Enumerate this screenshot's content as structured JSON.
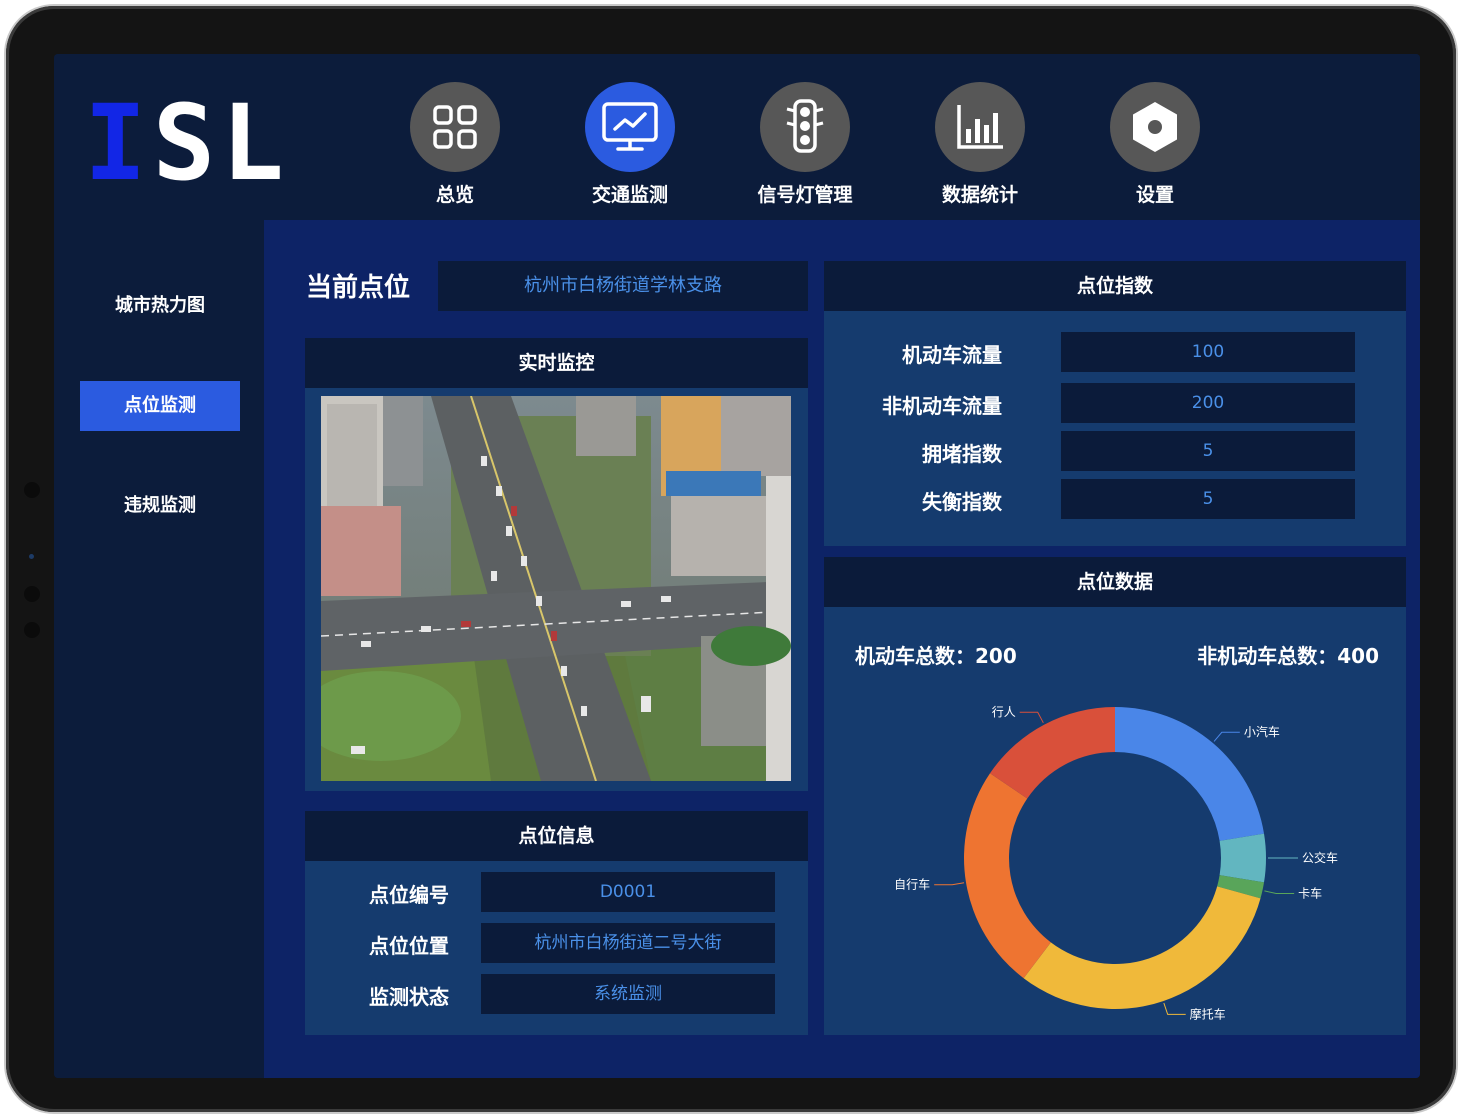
{
  "app": {
    "logo_part1": "I",
    "logo_part2": "SL"
  },
  "nav": {
    "items": [
      {
        "label": "总览",
        "icon": "grid-icon"
      },
      {
        "label": "交通监测",
        "icon": "monitor-chart-icon"
      },
      {
        "label": "信号灯管理",
        "icon": "traffic-light-icon"
      },
      {
        "label": "数据统计",
        "icon": "bar-chart-icon"
      },
      {
        "label": "设置",
        "icon": "hex-nut-icon"
      }
    ],
    "active_index": 1
  },
  "sidebar": {
    "items": [
      {
        "label": "城市热力图"
      },
      {
        "label": "点位监测"
      },
      {
        "label": "违规监测"
      }
    ],
    "active_index": 1
  },
  "current_point": {
    "label": "当前点位",
    "value": "杭州市白杨街道学林支路"
  },
  "live_monitor": {
    "title": "实时监控"
  },
  "point_info": {
    "title": "点位信息",
    "rows": [
      {
        "label": "点位编号",
        "value": "D0001"
      },
      {
        "label": "点位位置",
        "value": "杭州市白杨街道二号大街"
      },
      {
        "label": "监测状态",
        "value": "系统监测"
      }
    ]
  },
  "point_index": {
    "title": "点位指数",
    "rows": [
      {
        "label": "机动车流量",
        "value": "100"
      },
      {
        "label": "非机动车流量",
        "value": "200"
      },
      {
        "label": "拥堵指数",
        "value": "5"
      },
      {
        "label": "失衡指数",
        "value": "5"
      }
    ]
  },
  "point_data": {
    "title": "点位数据",
    "motor_total": "机动车总数：200",
    "non_motor_total": "非机动车总数：400"
  },
  "chart_data": {
    "type": "pie",
    "donut": true,
    "categories": [
      "小汽车",
      "公交车",
      "卡车",
      "摩托车",
      "自行车",
      "行人"
    ],
    "values": [
      130,
      30,
      10,
      180,
      140,
      90
    ],
    "colors": [
      "#4a86e8",
      "#62b6c0",
      "#59a55a",
      "#f0b93a",
      "#ee7431",
      "#d9503a"
    ]
  },
  "colors": {
    "accent": "#2b5be0",
    "value_text": "#4a90e8",
    "panel": "#153b6e",
    "panel_head": "#0b1b3a"
  }
}
